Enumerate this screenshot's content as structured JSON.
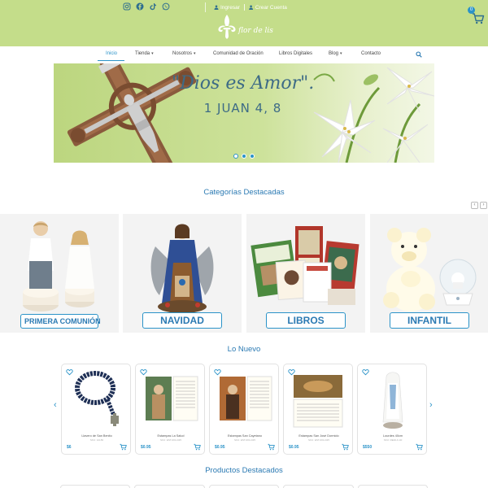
{
  "header": {
    "social_icons": [
      "instagram-icon",
      "facebook-icon",
      "tiktok-icon",
      "whatsapp-icon"
    ],
    "login_label": "Ingresar",
    "register_label": "Crear Cuenta",
    "logo_text": "flor de lis",
    "cart_count": "0"
  },
  "nav": {
    "items": [
      {
        "label": "Inicio"
      },
      {
        "label": "Tienda"
      },
      {
        "label": "Nosotros"
      },
      {
        "label": "Comunidad de Oración"
      },
      {
        "label": "Libros Digitales"
      },
      {
        "label": "Blog"
      },
      {
        "label": "Contacto"
      }
    ]
  },
  "hero": {
    "quote": "\"Dios es Amor\".",
    "reference": "1 JUAN 4, 8",
    "slides": 3,
    "active_slide": 1
  },
  "categories": {
    "title": "Categorías Destacadas",
    "items": [
      {
        "label": "PRIMERA COMUNIÓN"
      },
      {
        "label": "NAVIDAD"
      },
      {
        "label": "LIBROS"
      },
      {
        "label": "INFANTIL"
      }
    ]
  },
  "new_products": {
    "title": "Lo Nuevo",
    "items": [
      {
        "name": "Llavero de San Benito",
        "sku": "SKU: 12L56",
        "price": "$6"
      },
      {
        "name": "Estampas La Salud",
        "sku": "SKU: EST-001-D25",
        "price": "$0.95"
      },
      {
        "name": "Estampas San Cayetano",
        "sku": "SKU: EST-001-D25",
        "price": "$0.95"
      },
      {
        "name": "Estampas San José Dormido",
        "sku": "SKU: EST-001-D25",
        "price": "$0.95"
      },
      {
        "name": "Lourdes 40cm",
        "sku": "SKU: RE40-F-40",
        "price": "$550"
      }
    ]
  },
  "featured": {
    "title": "Productos Destacados"
  },
  "colors": {
    "header_bg": "#c4dd8a",
    "accent": "#2b93c8",
    "title_blue": "#2b7ab3"
  }
}
